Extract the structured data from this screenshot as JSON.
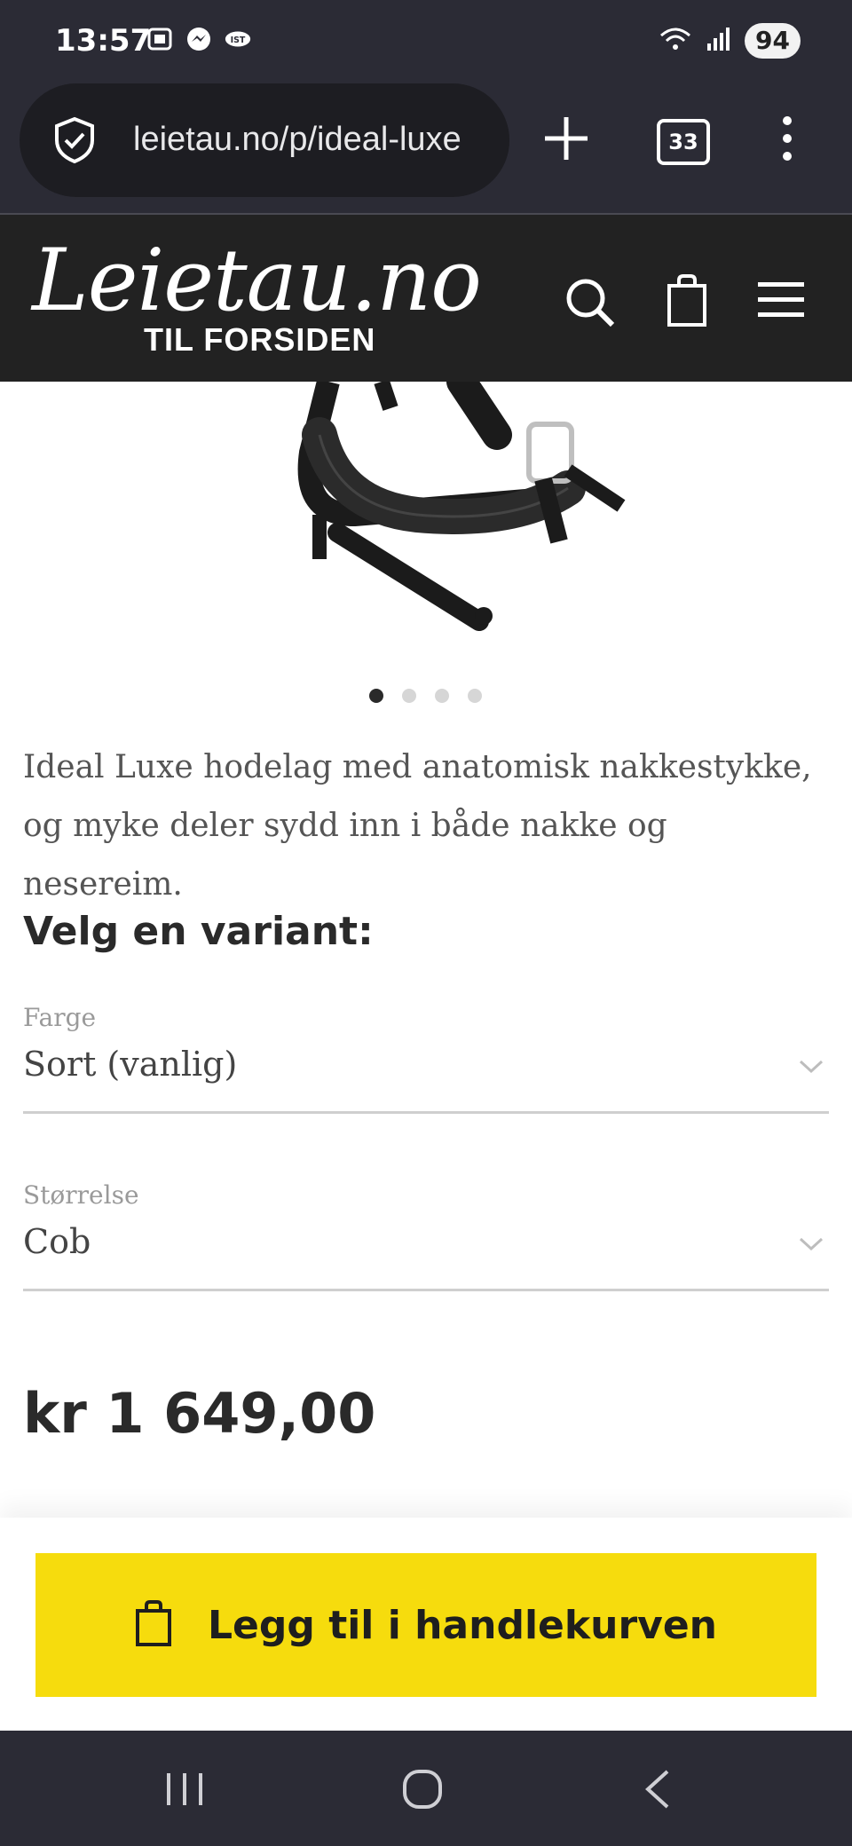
{
  "status_bar": {
    "time": "13:57",
    "battery": "94",
    "left_icons": [
      "screenshot-icon",
      "messenger-icon",
      "ist-icon"
    ],
    "right_icons": [
      "wifi-icon",
      "signal-icon"
    ]
  },
  "browser": {
    "url": "leietau.no/p/ideal-luxe",
    "tab_count": "33"
  },
  "site_header": {
    "logo_text": "Leietau.no",
    "logo_subtitle": "TIL FORSIDEN"
  },
  "product": {
    "carousel": {
      "total": 4,
      "active_index": 0
    },
    "description": "Ideal Luxe hodelag med anatomisk nakkestykke, og myke deler sydd inn i både nakke og nesereim.",
    "variant_heading": "Velg en variant:",
    "color_field": {
      "label": "Farge",
      "value": "Sort (vanlig)"
    },
    "size_field": {
      "label": "Størrelse",
      "value": "Cob"
    },
    "price": "kr 1 649,00"
  },
  "cart": {
    "button_label": "Legg til i handlekurven"
  },
  "colors": {
    "status_bar_bg": "#2b2b35",
    "header_bg": "#222222",
    "cart_button": "#f6dc0d"
  }
}
